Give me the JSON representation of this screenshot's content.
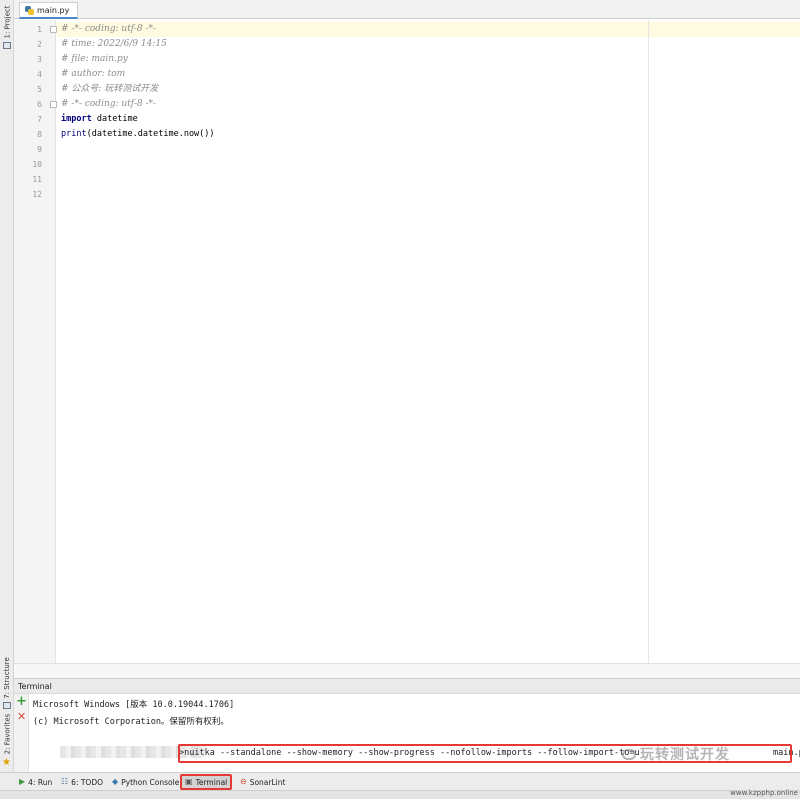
{
  "left_strip": {
    "project_label": "1: Project",
    "structure_label": "7: Structure",
    "favorites_label": "2: Favorites"
  },
  "tabs": [
    {
      "label": "main.py",
      "icon": "python-file-icon",
      "active": true
    }
  ],
  "editor": {
    "line_numbers": [
      "1",
      "2",
      "3",
      "4",
      "5",
      "6",
      "7",
      "8",
      "9",
      "10",
      "11",
      "12"
    ],
    "lines": [
      {
        "text": "# -*- coding: utf-8 -*-"
      },
      {
        "text": "# time: 2022/6/9 14:15"
      },
      {
        "text": "# file: main.py"
      },
      {
        "text": "# author: tom"
      },
      {
        "text": "# 公众号: 玩转测试开发"
      },
      {
        "text": "# -*- coding: utf-8 -*-"
      },
      {
        "keyword": "import",
        "rest": " datetime"
      },
      {
        "func": "print",
        "rest": "(datetime.datetime.now())"
      },
      {
        "text": ""
      },
      {
        "text": ""
      },
      {
        "text": ""
      },
      {
        "text": ""
      }
    ]
  },
  "terminal": {
    "title": "Terminal",
    "lines": [
      "Microsoft Windows [版本 10.0.19044.1706]",
      "(c) Microsoft Corporation。保留所有权利。"
    ],
    "command": ">nuitka --standalone --show-memory --show-progress --nofollow-imports --follow-import-to=u",
    "command_tail": "main.py",
    "watermark": "玩转测试开发"
  },
  "bottom_tools": [
    {
      "label": "4: Run",
      "icon": "run-icon"
    },
    {
      "label": "6: TODO",
      "icon": "todo-icon"
    },
    {
      "label": "Python Console",
      "icon": "python-console-icon"
    },
    {
      "label": "Terminal",
      "icon": "terminal-icon"
    },
    {
      "label": "SonarLint",
      "icon": "sonarlint-icon"
    }
  ],
  "site_watermark": "www.kzpphp.online",
  "colors": {
    "comment": "#8c8c8c",
    "keyword": "#000080",
    "highlight_box": "#e53935",
    "tab_underline": "#4a88c7"
  }
}
